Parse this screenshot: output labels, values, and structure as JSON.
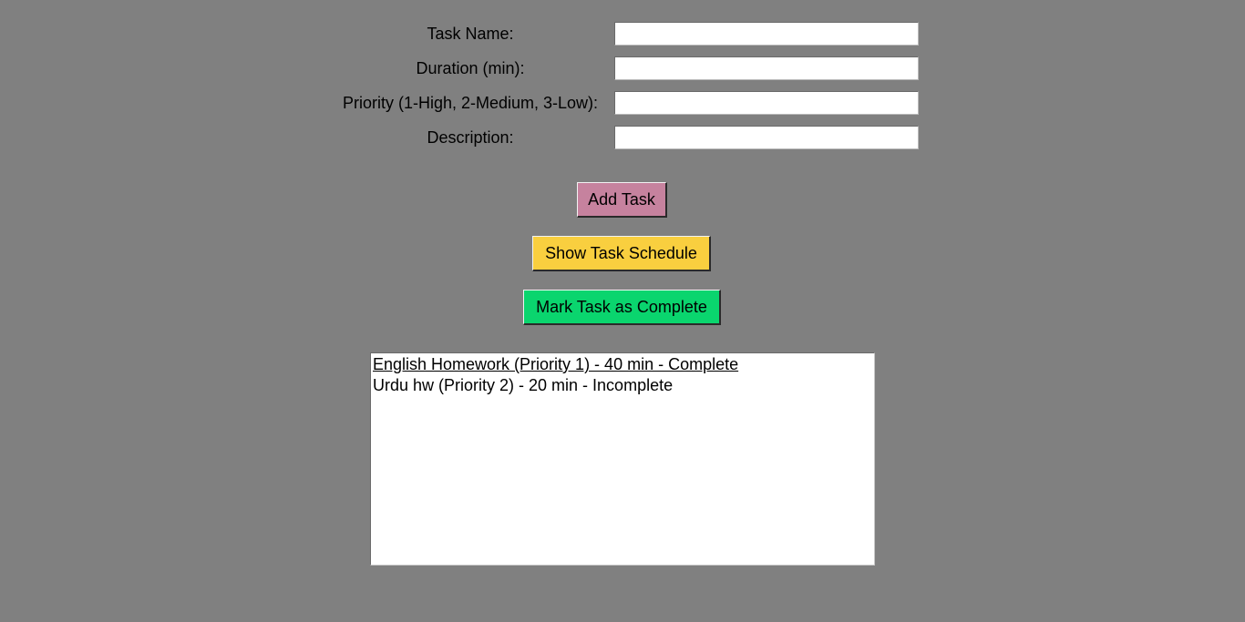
{
  "form": {
    "task_name_label": "Task Name:",
    "duration_label": "Duration (min):",
    "priority_label": "Priority (1-High, 2-Medium, 3-Low):",
    "description_label": "Description:",
    "task_name_value": "",
    "duration_value": "",
    "priority_value": "",
    "description_value": ""
  },
  "buttons": {
    "add_task": {
      "label": "Add Task",
      "color": "#c6829e"
    },
    "show_schedule": {
      "label": "Show Task Schedule",
      "color": "#f9cf3f"
    },
    "mark_complete": {
      "label": "Mark Task as Complete",
      "color": "#0ad56e"
    }
  },
  "task_list": {
    "items": [
      {
        "text": "English Homework (Priority 1) - 40 min - Complete",
        "active": true
      },
      {
        "text": "Urdu hw (Priority 2) - 20 min - Incomplete",
        "active": false
      }
    ]
  },
  "colors": {
    "background": "#808080"
  }
}
